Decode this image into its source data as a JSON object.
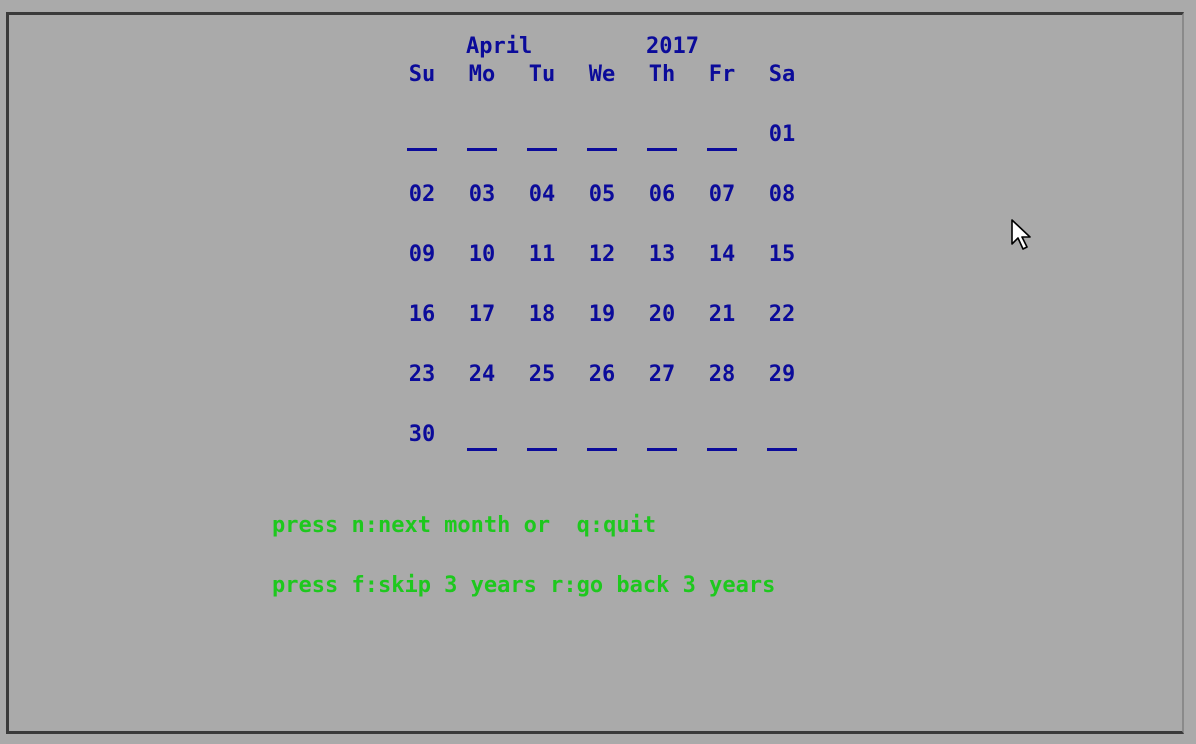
{
  "calendar": {
    "month": "April",
    "year": "2017",
    "weekdays": [
      "Su",
      "Mo",
      "Tu",
      "We",
      "Th",
      "Fr",
      "Sa"
    ],
    "weeks": [
      [
        "_",
        "_",
        "_",
        "_",
        "_",
        "_",
        "01"
      ],
      [
        "02",
        "03",
        "04",
        "05",
        "06",
        "07",
        "08"
      ],
      [
        "09",
        "10",
        "11",
        "12",
        "13",
        "14",
        "15"
      ],
      [
        "16",
        "17",
        "18",
        "19",
        "20",
        "21",
        "22"
      ],
      [
        "23",
        "24",
        "25",
        "26",
        "27",
        "28",
        "29"
      ],
      [
        "30",
        "_",
        "_",
        "_",
        "_",
        "_",
        "_"
      ]
    ]
  },
  "instructions": {
    "line1": "press n:next month or  q:quit",
    "line2": "press f:skip 3 years r:go back 3 years"
  },
  "colors": {
    "background": "#aaaaaa",
    "calendar": "#0b0b9a",
    "instructions": "#1ec81e"
  },
  "icons": {
    "pointer": "mouse-pointer-icon"
  }
}
